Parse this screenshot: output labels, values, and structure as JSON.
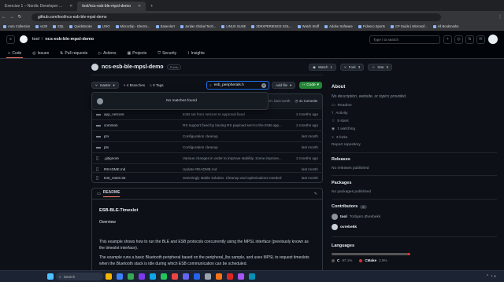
{
  "browser": {
    "tabs": [
      {
        "label": "Exercise 1 – Nordic Developer ..."
      },
      {
        "label": "tool/ncs-esb-ble-mpsl-demo"
      }
    ],
    "url": "github.com/tool/ncs-esb-ble-mpsl-demo",
    "bookmarks": [
      "Auto Collection",
      "vs30",
      "SQL",
      "QuickBooks",
      "LINO",
      "Microchip - Electro...",
      "EaseAlert",
      "Jordan Global Tech...",
      "LINUX SUSE",
      "3DEXPERIENCE SOL...",
      "Watch Stuff",
      "Adobe Software",
      "Fidesco Sports",
      "CP Guide | Microsof...",
      "All Bookmarks"
    ]
  },
  "gh": {
    "owner": "tool",
    "repo": "ncs-esb-ble-mpsl-demo",
    "search_placeholder": "Type / to search",
    "nav": [
      "Code",
      "Issues",
      "Pull requests",
      "Actions",
      "Projects",
      "Security",
      "Insights"
    ],
    "repo_title": "ncs-esb-ble-mpsl-demo",
    "visibility": "Public",
    "watch": {
      "label": "Watch",
      "count": "1"
    },
    "fork": {
      "label": "Fork",
      "count": "3"
    },
    "star": {
      "label": "Star",
      "count": "5"
    }
  },
  "toolbar": {
    "branch": "master",
    "branches": "4 Branches",
    "tags": "0 Tags",
    "file_search_value": "esb_peripherals.h",
    "add_file": "Add file",
    "code": "Code"
  },
  "dropdown": {
    "message": "No matches found"
  },
  "commit": {
    "time": "1h. last month",
    "commits": "41 Commits"
  },
  "files": [
    {
      "name": "app_netcore",
      "type": "folder",
      "message": "ESB set from netcore to approval fixed",
      "date": "2 months ago"
    },
    {
      "name": "common",
      "type": "folder",
      "message": "RX support fixed by having RX payload sent to the ESB app...",
      "date": "2 months ago"
    },
    {
      "name": "prx",
      "type": "folder",
      "message": "Configuration cleanup",
      "date": "last month"
    },
    {
      "name": "ptx",
      "type": "folder",
      "message": "Configuration cleanup",
      "date": "last month"
    },
    {
      "name": ".gitignore",
      "type": "file",
      "message": "Various changes in order to improve stability. Some improve...",
      "date": "3 months ago"
    },
    {
      "name": "README.md",
      "type": "file",
      "message": "Update README.md",
      "date": "last month"
    },
    {
      "name": "test_notes.txt",
      "type": "file",
      "message": "Seemingly stable solution. Cleanup and optimizations needed",
      "date": "last month"
    }
  ],
  "readme": {
    "tab": "README",
    "heading": "ESB-BLE-Timeslot",
    "overview": "Overview",
    "p1": "This example shows how to run the BLE and ESB protocols concurrently using the MPSL interface (previously known as the timeslot interface).",
    "p2": "The example runs a basic Bluetooth peripheral based on the peripheral_lbs sample, and uses MPSL to request timeslots when the Bluetooth stack is idle during which ESB communication can be scheduled."
  },
  "about": {
    "title": "About",
    "desc": "No description, website, or topics provided.",
    "items": [
      "Readme",
      "Activity",
      "5 stars",
      "1 watching",
      "3 forks"
    ],
    "report": "Report repository",
    "releases_title": "Releases",
    "releases_text": "No releases published",
    "packages_title": "Packages",
    "packages_text": "No packages published",
    "contributors_title": "Contributors",
    "contributors_count": "2",
    "contributors": [
      {
        "name": "tool",
        "full": "Torbjørn Øvrebekk"
      },
      {
        "name": "ovrebekk",
        "full": ""
      }
    ],
    "languages_title": "Languages",
    "languages": [
      {
        "name": "C",
        "percent": "97.1%",
        "color": "#555555"
      },
      {
        "name": "CMake",
        "percent": "2.9%",
        "color": "#da3434"
      }
    ]
  },
  "taskbar": {
    "search": "Search"
  }
}
